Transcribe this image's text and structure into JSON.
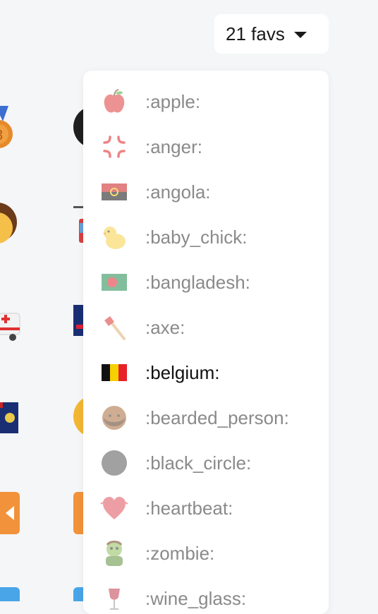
{
  "favs_button": {
    "label": "21 favs",
    "icon": "caret-down-icon"
  },
  "dropdown": {
    "items": [
      {
        "label": ":apple:",
        "icon": "apple-icon",
        "active": false
      },
      {
        "label": ":anger:",
        "icon": "anger-icon",
        "active": false
      },
      {
        "label": ":angola:",
        "icon": "flag-angola-icon",
        "active": false
      },
      {
        "label": ":baby_chick:",
        "icon": "baby-chick-icon",
        "active": false
      },
      {
        "label": ":bangladesh:",
        "icon": "flag-bangladesh-icon",
        "active": false
      },
      {
        "label": ":axe:",
        "icon": "axe-icon",
        "active": false
      },
      {
        "label": ":belgium:",
        "icon": "flag-belgium-icon",
        "active": true
      },
      {
        "label": ":bearded_person:",
        "icon": "bearded-person-icon",
        "active": false
      },
      {
        "label": ":black_circle:",
        "icon": "black-circle-icon",
        "active": false
      },
      {
        "label": ":heartbeat:",
        "icon": "heartbeat-icon",
        "active": false
      },
      {
        "label": ":zombie:",
        "icon": "zombie-icon",
        "active": false
      },
      {
        "label": ":wine_glass:",
        "icon": "wine-glass-icon",
        "active": false
      }
    ]
  },
  "background_grid": {
    "icons": [
      "medal-icon",
      "black-ball-icon",
      "person-face-icon",
      "train-icon",
      "ambulance-icon",
      "flag-icon",
      "flag-icon",
      "smiley-face-icon",
      "rewind-button-icon",
      "orange-square-icon",
      "blue-square-icon",
      "blue-square-icon"
    ]
  }
}
